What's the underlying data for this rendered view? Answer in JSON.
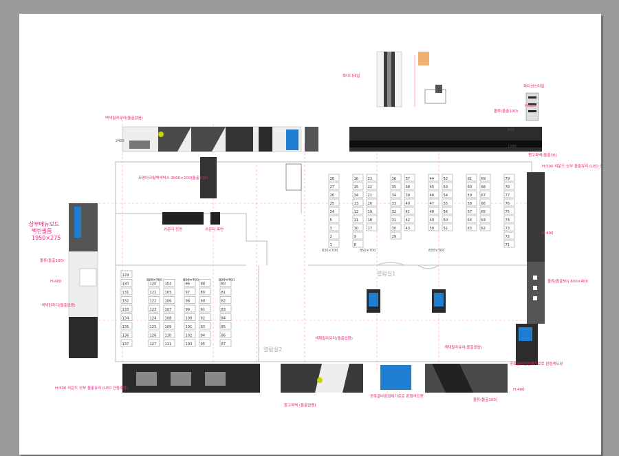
{
  "title_views": {
    "elevation_left": "확대디테일",
    "elevation_right": "파티션스타일"
  },
  "rooms": {
    "room1": "열람실1",
    "room2": "열람실2"
  },
  "labels": {
    "acrylic_black": "백색필라유리(돌출없음)",
    "signage_top": "몰류(돌출100)",
    "wall_art": "청고파벽(돌출30)",
    "top_menu_board": "상부메뉴보드",
    "top_menu_sub": "백린필름",
    "top_menu_size": "1950×275",
    "counter_front": "카운터 전면",
    "counter_side": "카운터 측면",
    "metal_box": "조명아크릴백색박스 2000×200(돌출100)",
    "led_note": "H:500 라운드 상부 돌출유리 (LED 간접조명)",
    "pattern_wall": "공축골바판점체가로로 판형색도장",
    "molding_side": "몰류(돌출50) 600×400",
    "mirror": "색색핀라디(돌출없음)",
    "h400": "H:400",
    "h500": "H:500",
    "size_2400": "2400",
    "size_1200": "1200",
    "size_800": "800",
    "cell_830": "830×700",
    "cell_850": "850×700",
    "cell_820": "820×700",
    "mirror_bottom": "색재필라유리(돌출없음)",
    "storage": "참고파벽 (돌출없음)",
    "molding_100": "몰류(돌출100)"
  },
  "upper_seats": [
    [
      28,
      16,
      23,
      36,
      37,
      44,
      52,
      61,
      69,
      79
    ],
    [
      27,
      15,
      22,
      35,
      38,
      45,
      53,
      60,
      68,
      78
    ],
    [
      26,
      14,
      21,
      34,
      39,
      46,
      54,
      59,
      67,
      77
    ],
    [
      25,
      13,
      20,
      33,
      40,
      47,
      55,
      58,
      66,
      76
    ],
    [
      24,
      12,
      19,
      32,
      41,
      48,
      56,
      57,
      65,
      75
    ],
    [
      5,
      11,
      18,
      31,
      42,
      49,
      50,
      64,
      63,
      74
    ],
    [
      3,
      10,
      17,
      30,
      43,
      50,
      51,
      63,
      62,
      73
    ],
    [
      2,
      9,
      null,
      29,
      null,
      null,
      null,
      null,
      null,
      72
    ],
    [
      1,
      8,
      null,
      null,
      null,
      null,
      null,
      null,
      null,
      71
    ]
  ],
  "lower_seats": [
    [
      129,
      null,
      null,
      null,
      null,
      null
    ],
    [
      130,
      120,
      104,
      96,
      88,
      80
    ],
    [
      131,
      121,
      105,
      97,
      89,
      81
    ],
    [
      132,
      122,
      106,
      98,
      90,
      82
    ],
    [
      133,
      123,
      107,
      99,
      91,
      83
    ],
    [
      134,
      124,
      108,
      100,
      92,
      84
    ],
    [
      135,
      125,
      109,
      101,
      93,
      85
    ],
    [
      136,
      126,
      110,
      102,
      94,
      86
    ],
    [
      137,
      127,
      111,
      103,
      95,
      87
    ]
  ],
  "colors": {
    "accent": "#e8207a",
    "green_logo": "#c8d400",
    "blue_panel": "#1e7fd0",
    "dark_wall": "#3a3a3a"
  }
}
